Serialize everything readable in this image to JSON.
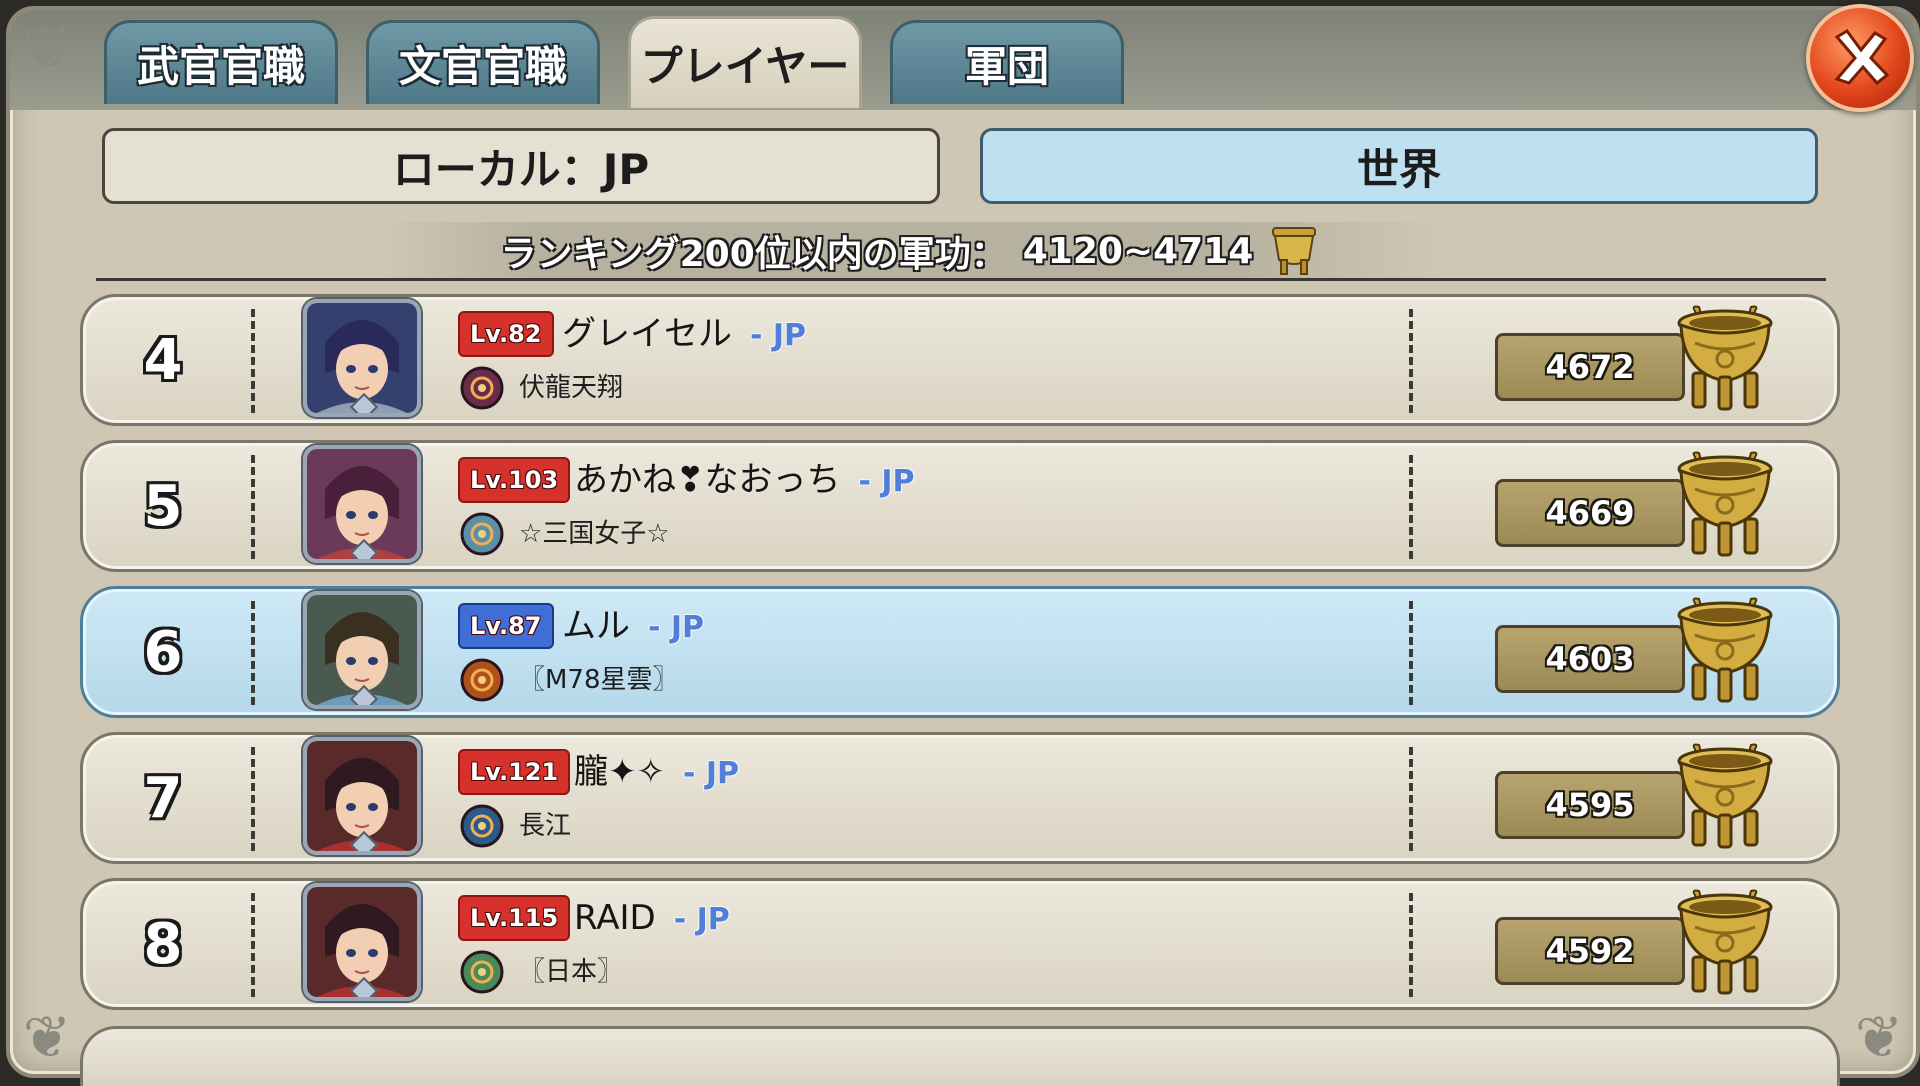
{
  "tabs": [
    {
      "label": "武官官職",
      "active": false
    },
    {
      "label": "文官官職",
      "active": false
    },
    {
      "label": "プレイヤー",
      "active": true
    },
    {
      "label": "軍団",
      "active": false
    }
  ],
  "scope": {
    "local_label": "ローカル：JP",
    "world_label": "世界",
    "selected": "世界"
  },
  "banner": {
    "text": "ランキング200位以内の軍功：",
    "range": "4120~4714"
  },
  "icons": {
    "close": "close-x-icon",
    "merit": "bronze-cauldron-icon"
  },
  "colors": {
    "level_red": "#d6322b",
    "level_blue": "#3f6fd6",
    "server_blue": "#4f7fd8",
    "highlight_row": "#b4d8ea"
  },
  "rows": [
    {
      "rank": "4",
      "level": "Lv.82",
      "name": "グレイセル",
      "server": "- JP",
      "guild": "伏龍天翔",
      "score": "4672",
      "highlight": false
    },
    {
      "rank": "5",
      "level": "Lv.103",
      "name": "あかね❣なおっち",
      "server": "- JP",
      "guild": "☆三国女子☆",
      "score": "4669",
      "highlight": false
    },
    {
      "rank": "6",
      "level": "Lv.87",
      "name": "ムル",
      "server": "- JP",
      "guild": "〖M78星雲〗",
      "score": "4603",
      "highlight": true
    },
    {
      "rank": "7",
      "level": "Lv.121",
      "name": "朧✦✧",
      "server": "- JP",
      "guild": "長江",
      "score": "4595",
      "highlight": false
    },
    {
      "rank": "8",
      "level": "Lv.115",
      "name": "RAID",
      "server": "- JP",
      "guild": "〖日本〗",
      "score": "4592",
      "highlight": false
    }
  ]
}
